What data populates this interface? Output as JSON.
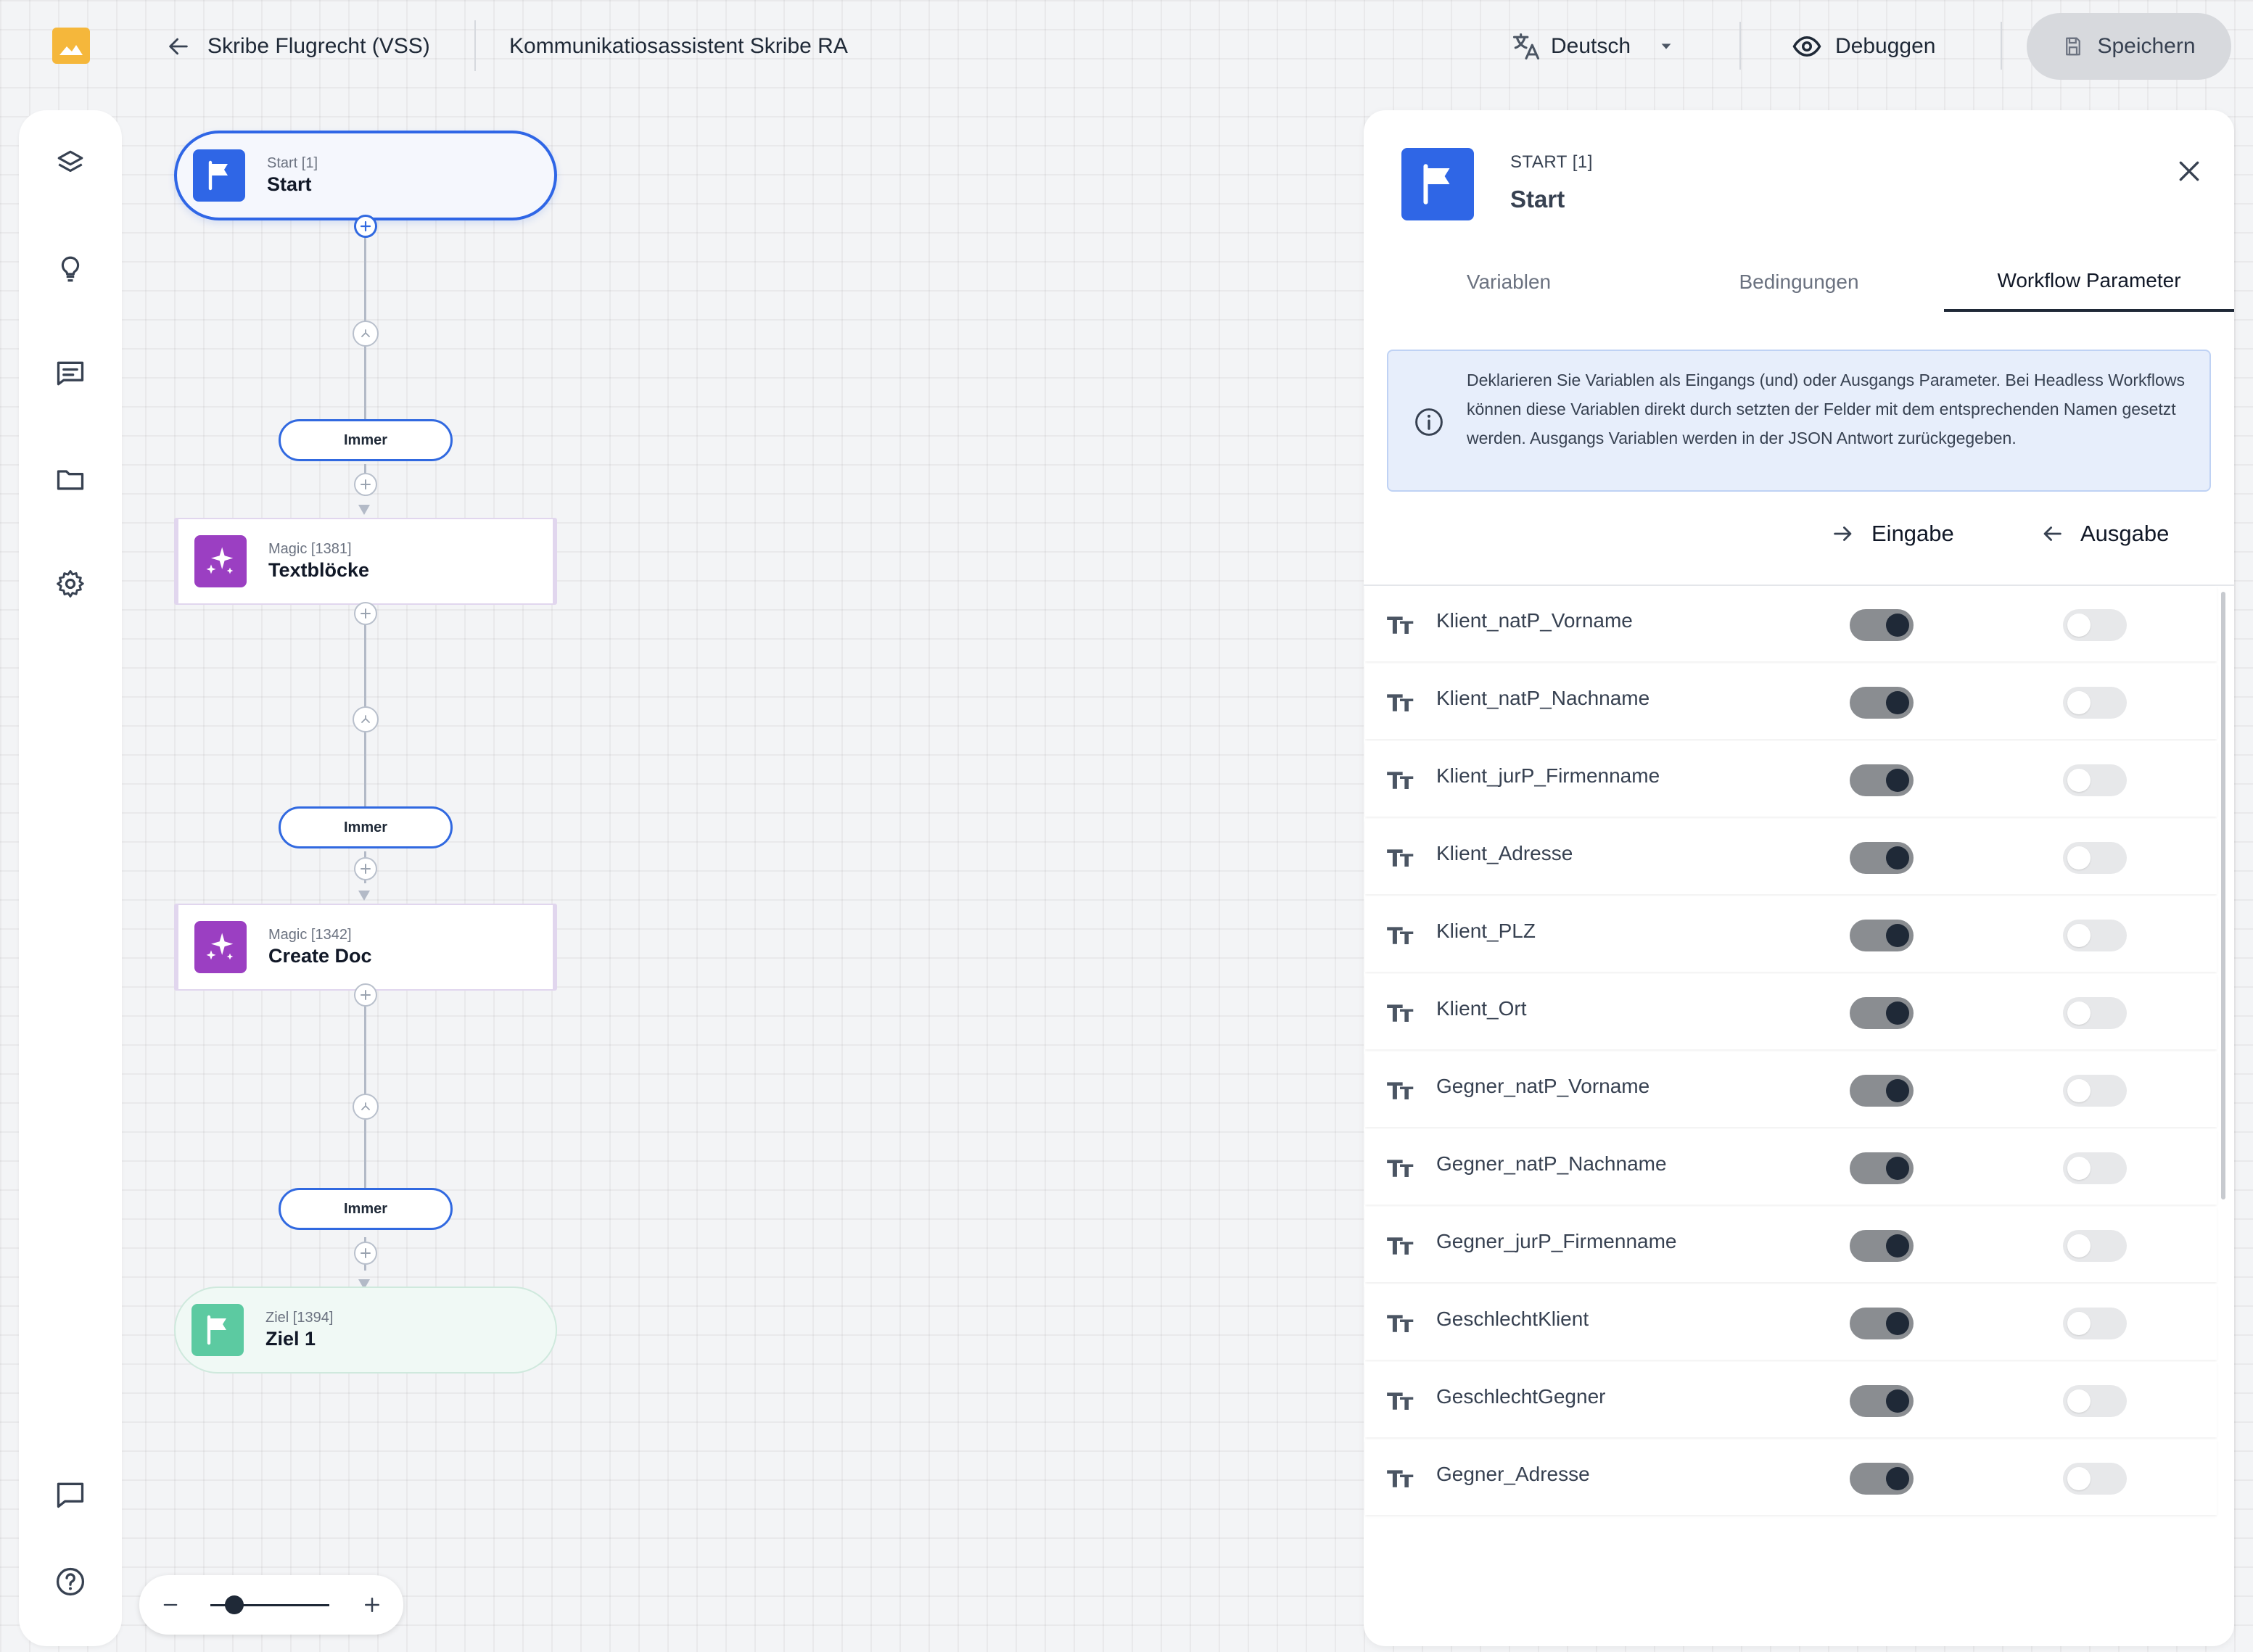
{
  "header": {
    "project": "Skribe Flugrecht (VSS)",
    "workflow_title": "Kommunikatiosassistent Skribe RA",
    "language": "Deutsch",
    "debug_label": "Debuggen",
    "save_label": "Speichern"
  },
  "sidebar": {
    "icons": [
      "layers-icon",
      "lightbulb-icon",
      "messages-icon",
      "folder-icon",
      "settings-icon",
      "chat-bubble-icon",
      "help-icon"
    ]
  },
  "flow": {
    "nodes": [
      {
        "kind": "Start [1]",
        "label": "Start",
        "type": "start"
      },
      {
        "kind": "Magic [1381]",
        "label": "Textblöcke",
        "type": "magic"
      },
      {
        "kind": "Magic [1342]",
        "label": "Create Doc",
        "type": "magic"
      },
      {
        "kind": "Ziel [1394]",
        "label": "Ziel 1",
        "type": "goal"
      }
    ],
    "conditions": [
      "Immer",
      "Immer",
      "Immer"
    ]
  },
  "zoom": {
    "level": 0.2
  },
  "panel": {
    "kind": "START [1]",
    "title": "Start",
    "tabs": [
      "Variablen",
      "Bedingungen",
      "Workflow Parameter"
    ],
    "active_tab": "Workflow Parameter",
    "info": "Deklarieren Sie Variablen als Eingangs (und) oder Ausgangs Parameter. Bei Headless Workflows können diese Variablen direkt durch setzten der Felder mit dem entsprechenden Namen gesetzt werden. Ausgangs Variablen werden in der JSON Antwort zurückgegeben.",
    "col_input": "Eingabe",
    "col_output": "Ausgabe",
    "variables": [
      {
        "name": "Klient_natP_Vorname",
        "input": true,
        "output": false
      },
      {
        "name": "Klient_natP_Nachname",
        "input": true,
        "output": false
      },
      {
        "name": "Klient_jurP_Firmenname",
        "input": true,
        "output": false
      },
      {
        "name": "Klient_Adresse",
        "input": true,
        "output": false
      },
      {
        "name": "Klient_PLZ",
        "input": true,
        "output": false
      },
      {
        "name": "Klient_Ort",
        "input": true,
        "output": false
      },
      {
        "name": "Gegner_natP_Vorname",
        "input": true,
        "output": false
      },
      {
        "name": "Gegner_natP_Nachname",
        "input": true,
        "output": false
      },
      {
        "name": "Gegner_jurP_Firmenname",
        "input": true,
        "output": false
      },
      {
        "name": "GeschlechtKlient",
        "input": true,
        "output": false
      },
      {
        "name": "GeschlechtGegner",
        "input": true,
        "output": false
      },
      {
        "name": "Gegner_Adresse",
        "input": true,
        "output": false
      }
    ]
  },
  "colors": {
    "accent": "#2f66e6",
    "magic": "#9b3fc2",
    "goal": "#5ccaa1",
    "logo": "#f5b73b"
  }
}
